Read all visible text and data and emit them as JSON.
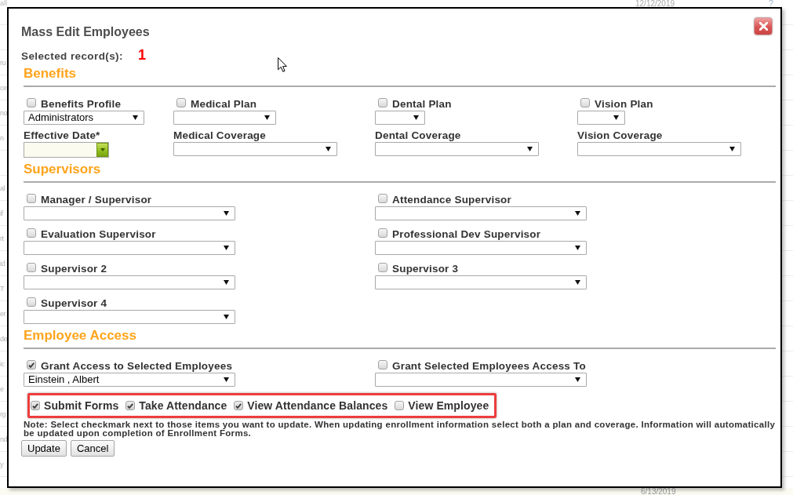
{
  "background_page": {
    "top_row": {
      "cut_text": "all",
      "date": "12/12/2019",
      "mark": "?"
    },
    "left_column": [
      "ru",
      "ce",
      "no",
      "n",
      "al",
      "if",
      "rt",
      "id",
      "T",
      "er",
      "de",
      "ic",
      "e",
      "rg",
      "nd",
      "y"
    ],
    "bottom_row": {
      "date": "6/13/2019"
    }
  },
  "dialog": {
    "title": "Mass Edit Employees",
    "selected_records": {
      "label": "Selected record(s):",
      "count": "1"
    },
    "sections": [
      {
        "kind": "benefits",
        "heading": "Benefits",
        "fields": [
          {
            "kind": "checkbox-select",
            "label": "Benefits Profile",
            "checked": false,
            "value": "Administrators"
          },
          {
            "kind": "checkbox-select",
            "label": "Medical Plan",
            "checked": false
          },
          {
            "kind": "checkbox-select",
            "label": "Dental Plan",
            "checked": false
          },
          {
            "kind": "checkbox-select",
            "label": "Vision Plan",
            "checked": false
          },
          {
            "kind": "date",
            "label": "Effective Date*"
          },
          {
            "kind": "select",
            "label": "Medical Coverage"
          },
          {
            "kind": "select",
            "label": "Dental Coverage"
          },
          {
            "kind": "select",
            "label": "Vision Coverage"
          }
        ]
      },
      {
        "kind": "supervisors",
        "heading": "Supervisors",
        "fields": [
          {
            "kind": "checkbox-select",
            "label": "Manager / Supervisor",
            "checked": false
          },
          {
            "kind": "checkbox-select",
            "label": "Attendance Supervisor",
            "checked": false
          },
          {
            "kind": "checkbox-select",
            "label": "Evaluation Supervisor",
            "checked": false
          },
          {
            "kind": "checkbox-select",
            "label": "Professional Dev Supervisor",
            "checked": false
          },
          {
            "kind": "checkbox-select",
            "label": "Supervisor 2",
            "checked": false
          },
          {
            "kind": "checkbox-select",
            "label": "Supervisor 3",
            "checked": false
          },
          {
            "kind": "checkbox-select",
            "label": "Supervisor 4",
            "checked": false
          }
        ]
      },
      {
        "kind": "access",
        "heading": "Employee Access",
        "fields": [
          {
            "kind": "checkbox-select",
            "label": "Grant Access to Selected Employees",
            "checked": true,
            "value": "Einstein , Albert"
          },
          {
            "kind": "checkbox-select",
            "label": "Grant Selected Employees Access To",
            "checked": false
          }
        ],
        "permissions": {
          "highlighted": true,
          "items": [
            {
              "label": "Submit Forms",
              "checked": true
            },
            {
              "label": "Take Attendance",
              "checked": true
            },
            {
              "label": "View Attendance Balances",
              "checked": true
            },
            {
              "label": "View Employee",
              "checked": false
            }
          ]
        }
      }
    ],
    "note": "Note: Select checkmark next to those items you want to update. When updating enrollment information select both a plan and coverage. Information will automatically be updated upon completion of Enrollment Forms.",
    "buttons": [
      "Update",
      "Cancel"
    ]
  }
}
